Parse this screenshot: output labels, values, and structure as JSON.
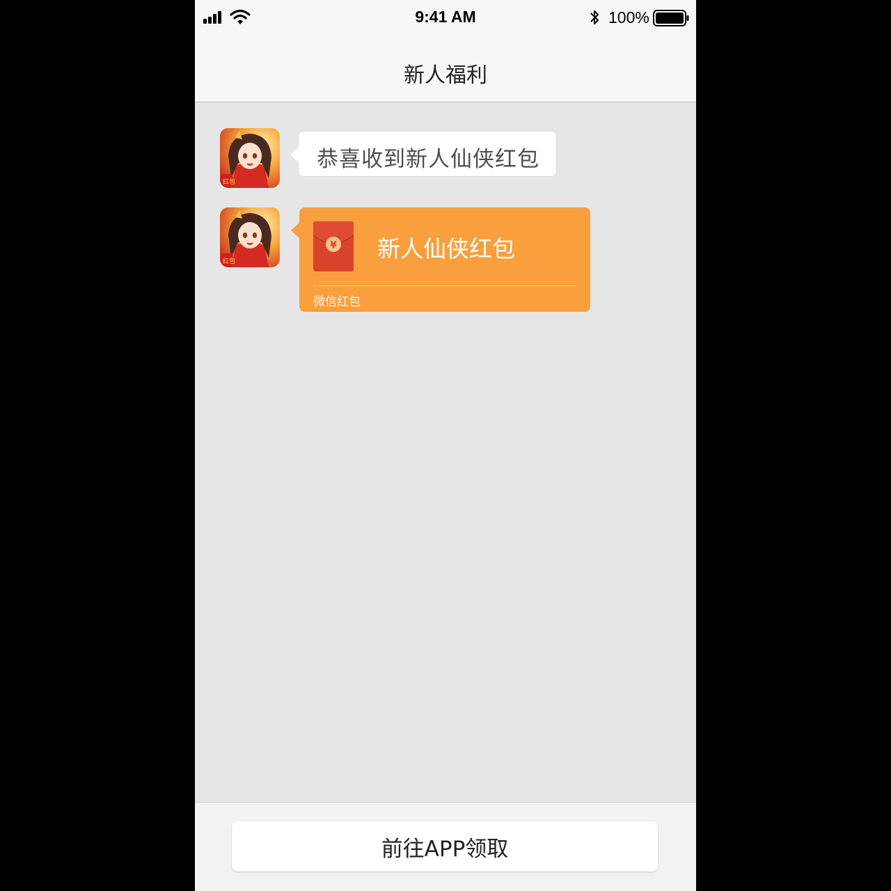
{
  "status_bar": {
    "time": "9:41 AM",
    "battery_percent": "100%",
    "icons": [
      "signal-icon",
      "wifi-icon",
      "bluetooth-icon",
      "battery-icon"
    ]
  },
  "nav": {
    "title": "新人福利"
  },
  "messages": [
    {
      "type": "text",
      "text": "恭喜收到新人仙侠红包"
    },
    {
      "type": "red_packet",
      "title": "新人仙侠红包",
      "footer": "微信红包",
      "currency_symbol": "¥"
    }
  ],
  "bottom": {
    "claim_label": "前往APP领取"
  },
  "colors": {
    "red_packet_bg": "#f99f3d",
    "envelope": "#d9432b",
    "chat_bg": "#e6e6e6",
    "nav_bg": "#f7f7f7"
  }
}
